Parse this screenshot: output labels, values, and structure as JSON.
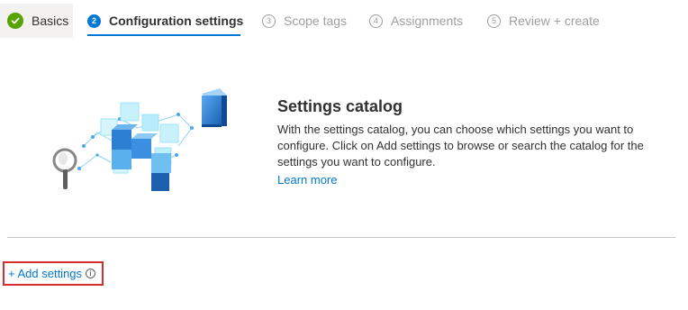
{
  "wizard": {
    "steps": [
      {
        "number": "",
        "label": "Basics",
        "state": "completed"
      },
      {
        "number": "2",
        "label": "Configuration settings",
        "state": "active"
      },
      {
        "number": "3",
        "label": "Scope tags",
        "state": "inactive"
      },
      {
        "number": "4",
        "label": "Assignments",
        "state": "inactive"
      },
      {
        "number": "5",
        "label": "Review + create",
        "state": "inactive"
      }
    ]
  },
  "catalog": {
    "title": "Settings catalog",
    "description": "With the settings catalog, you can choose which settings you want to configure. Click on Add settings to browse or search the catalog for the settings you want to configure.",
    "learn_more": "Learn more",
    "illustration": "cubes-and-magnifier-illustration"
  },
  "actions": {
    "add_settings": "+ Add settings",
    "info_glyph": "i"
  },
  "colors": {
    "accent": "#0078d4",
    "completed": "#57a300",
    "highlight_box": "#d62e2e",
    "inactive_text": "#a19f9d"
  }
}
